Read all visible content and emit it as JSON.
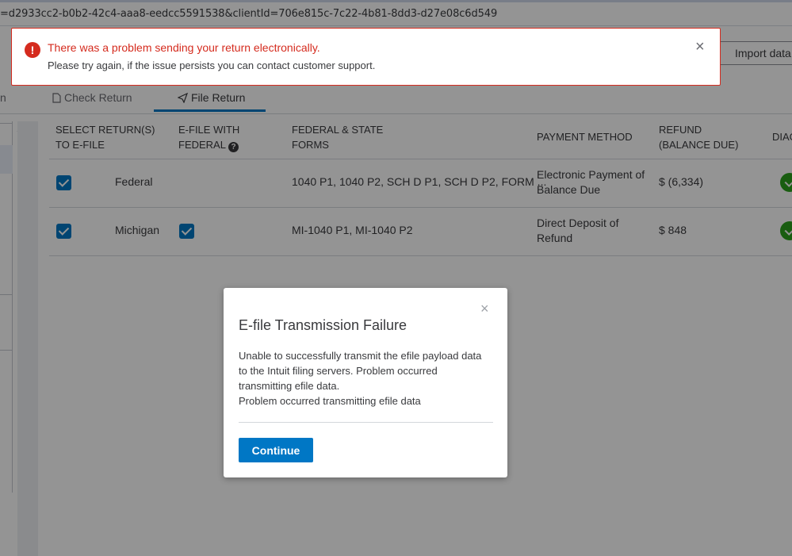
{
  "browser": {
    "url": "=d2933cc2-b0b2-42c4-aaa8-eedcc5591538&clientId=706e815c-7c22-4b81-8dd3-d27e08c6d549"
  },
  "header": {
    "import_label": "Import data"
  },
  "tabs": {
    "partial_label": "n",
    "items": [
      {
        "label": "Check Return",
        "icon": "document-icon"
      },
      {
        "label": "File Return",
        "icon": "send-icon",
        "active": true
      }
    ]
  },
  "table": {
    "headers": {
      "select": [
        "SELECT RETURN(S)",
        "TO E-FILE"
      ],
      "efile_with": [
        "E-FILE WITH",
        "FEDERAL"
      ],
      "forms": [
        "FEDERAL & STATE",
        "FORMS"
      ],
      "payment": "PAYMENT METHOD",
      "refund": [
        "REFUND",
        "(BALANCE DUE)"
      ],
      "diag": "DIAG"
    },
    "rows": [
      {
        "selected": true,
        "name": "Federal",
        "efile_with_federal": false,
        "forms": "1040 P1, 1040 P2, SCH D P1, SCH D P2, FORM ...",
        "payment": [
          "Electronic Payment of",
          "Balance Due"
        ],
        "refund": "$ (6,334)",
        "diag_status": "ok"
      },
      {
        "selected": true,
        "name": "Michigan",
        "efile_with_federal": true,
        "forms": "MI-1040 P1, MI-1040 P2",
        "payment": [
          "Direct Deposit of",
          "Refund"
        ],
        "refund": "$ 848",
        "diag_status": "ok"
      }
    ]
  },
  "banner": {
    "icon": "!",
    "title": "There was a problem sending your return electronically.",
    "message": "Please try again, if the issue persists you can contact customer support.",
    "close": "×",
    "color": "#d52b1e"
  },
  "modal": {
    "close": "×",
    "title": "E-file Transmission Failure",
    "body_lines": [
      "Unable to successfully transmit the efile payload data",
      "to the Intuit filing servers. Problem occurred",
      "transmitting efile data.",
      "Problem occurred transmitting efile data"
    ],
    "button_label": "Continue",
    "accent": "#0077c5"
  }
}
